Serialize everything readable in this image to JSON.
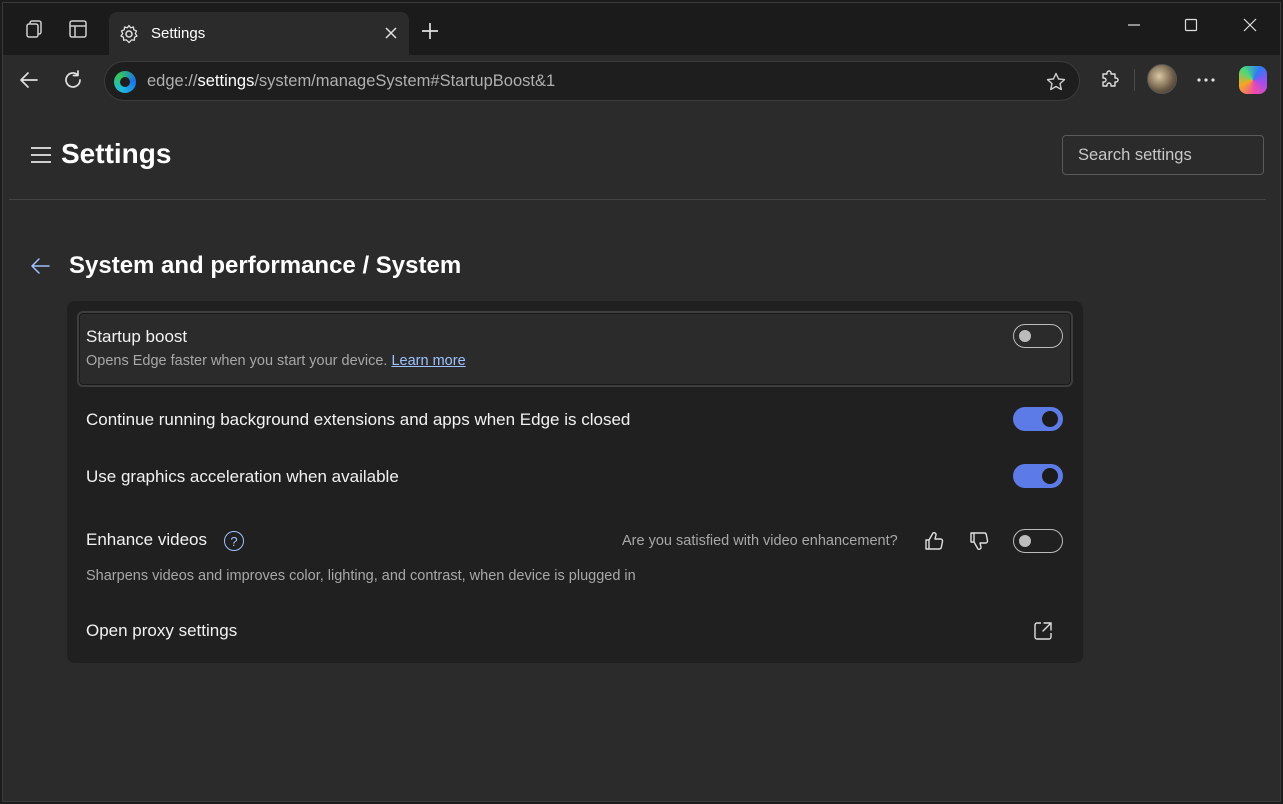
{
  "tabstrip": {
    "tab_title": "Settings"
  },
  "navbar": {
    "url_scheme": "edge://",
    "url_host": "settings",
    "url_path": "/system/manageSystem#StartupBoost&1"
  },
  "header": {
    "title": "Settings",
    "search_placeholder": "Search settings"
  },
  "section": {
    "title": "System and performance / System"
  },
  "settings": {
    "startup_boost": {
      "label": "Startup boost",
      "description": "Opens Edge faster when you start your device.",
      "link": "Learn more",
      "enabled": false
    },
    "background_apps": {
      "label": "Continue running background extensions and apps when Edge is closed",
      "enabled": true
    },
    "graphics_accel": {
      "label": "Use graphics acceleration when available",
      "enabled": true
    },
    "enhance_videos": {
      "label": "Enhance videos",
      "help": "?",
      "feedback_question": "Are you satisfied with video enhancement?",
      "description": "Sharpens videos and improves color, lighting, and contrast, when device is plugged in",
      "enabled": false
    },
    "proxy": {
      "label": "Open proxy settings"
    }
  },
  "colors": {
    "accent": "#5d7be6",
    "link": "#9ec2ff"
  }
}
